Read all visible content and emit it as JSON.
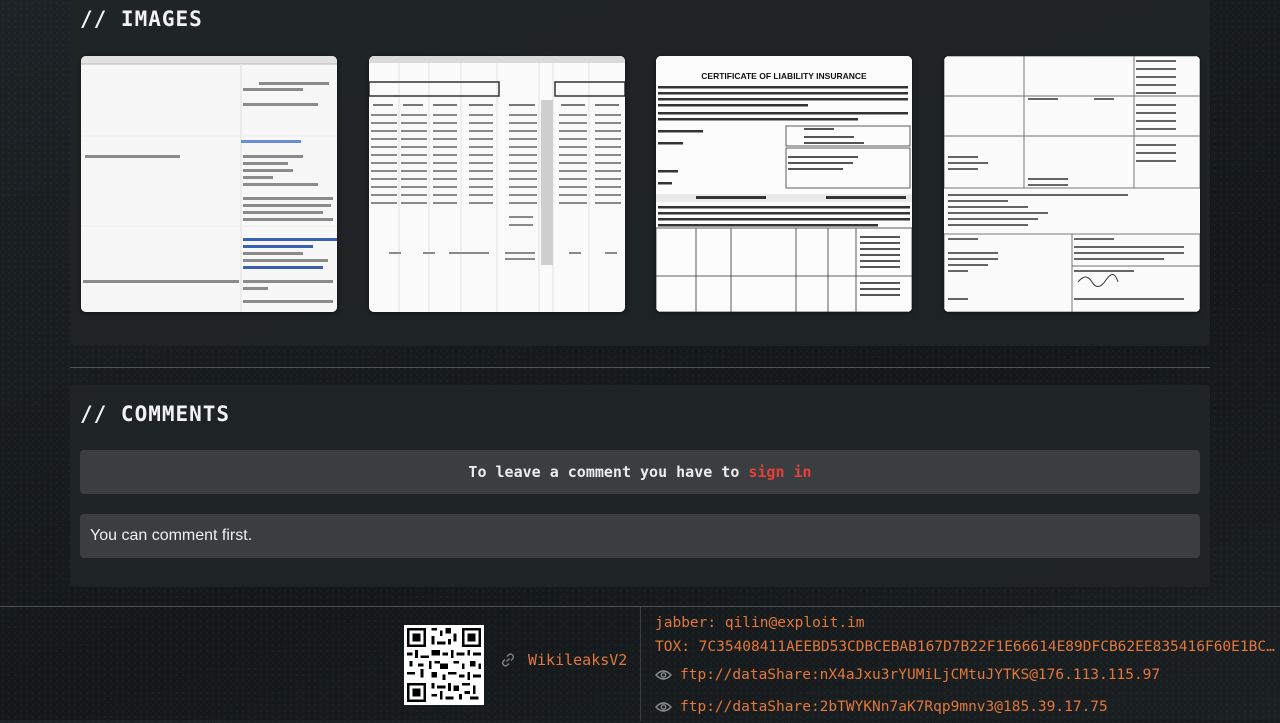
{
  "images_section": {
    "title": "// IMAGES",
    "images": [
      {
        "label": "screenshot-email-list"
      },
      {
        "label": "screenshot-spreadsheet"
      },
      {
        "label": "screenshot-certificate"
      },
      {
        "label": "screenshot-insurance-form"
      }
    ],
    "certificate_heading": "CERTIFICATE OF LIABILITY INSURANCE"
  },
  "comments_section": {
    "title": "// COMMENTS",
    "signin_prompt": "To leave a comment you have to",
    "signin_link": "sign in",
    "empty_message": "You can comment first."
  },
  "footer": {
    "wiki_link": "WikileaksV2",
    "jabber": "jabber: qilin@exploit.im",
    "tox": "TOX: 7C35408411AEEBD53CDBCEBAB167D7B22F1E66614E89DFCB62EE835416F60E1BC…",
    "ftp_1": "ftp://dataShare:nX4aJxu3rYUMiLjCMtuJYTKS@176.113.115.97",
    "ftp_2": "ftp://dataShare:2bTWYKNn7aK7Rqp9mnv3@185.39.17.75"
  },
  "colors": {
    "accent_orange": "#e3773c",
    "signin_red": "#e2403a",
    "panel_bg": "#202426"
  }
}
